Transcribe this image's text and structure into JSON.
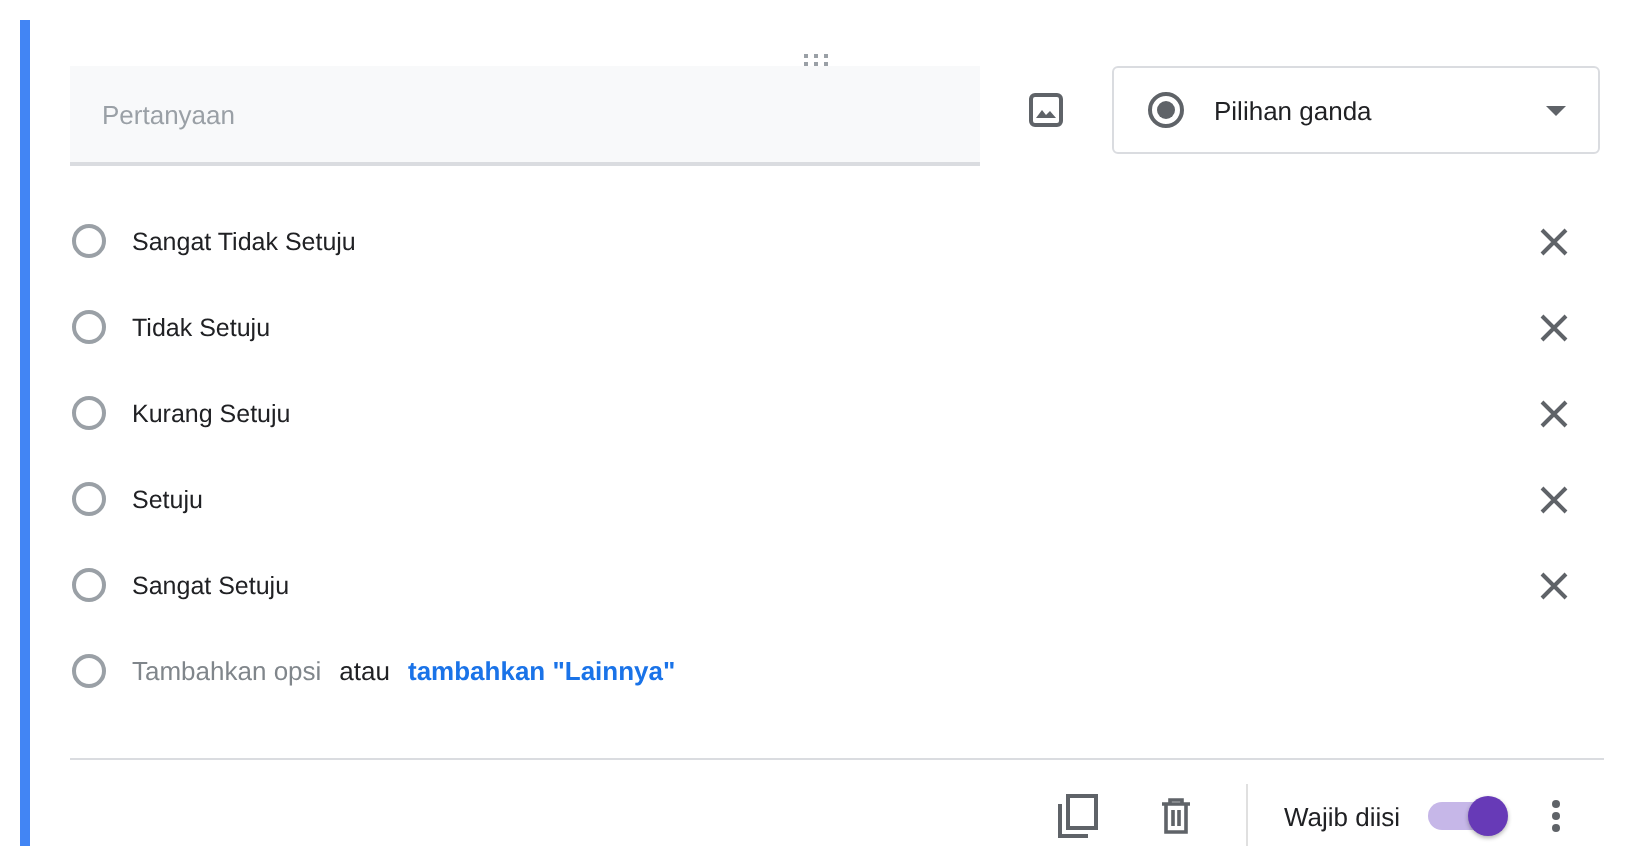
{
  "question": {
    "placeholder": "Pertanyaan"
  },
  "type_dropdown": {
    "label": "Pilihan ganda"
  },
  "options": [
    {
      "label": "Sangat Tidak Setuju",
      "selected": false
    },
    {
      "label": "Tidak Setuju",
      "selected": false
    },
    {
      "label": "Kurang Setuju",
      "selected": false
    },
    {
      "label": "Setuju",
      "selected": false
    },
    {
      "label": "Sangat Setuju",
      "selected": false
    }
  ],
  "add_option": {
    "label": "Tambahkan opsi",
    "separator": "atau",
    "other_link": "tambahkan \"Lainnya\"",
    "selected": false
  },
  "footer": {
    "required_label": "Wajib diisi",
    "required": true
  }
}
